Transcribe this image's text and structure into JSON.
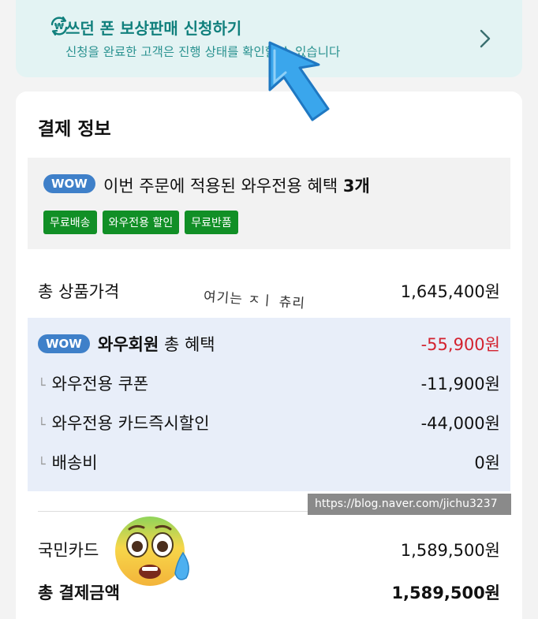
{
  "trade_in": {
    "title": "쓰던 폰 보상판매 신청하기",
    "subtitle": "신청을 완료한 고객은 진행 상태를 확인할 수 있습니다",
    "icon": "won-refresh-icon",
    "chevron": "chevron-right-icon"
  },
  "payment": {
    "title": "결제 정보",
    "wow_badge": "WOW",
    "wow_intro": "이번 주문에 적용된 와우전용 혜택",
    "wow_count": "3개",
    "chips": [
      "무료배송",
      "와우전용 할인",
      "무료반품"
    ],
    "product_total_label": "총 상품가격",
    "product_total_value": "1,645,400원",
    "benefit": {
      "badge": "WOW",
      "title_bold": "와우회원",
      "title_rest": "총 혜택",
      "total": "-55,900원",
      "items": [
        {
          "tick": "└",
          "label": "와우전용 쿠폰",
          "value": "-11,900원"
        },
        {
          "tick": "└",
          "label": "와우전용 카드즉시할인",
          "value": "-44,000원"
        },
        {
          "tick": "└",
          "label": "배송비",
          "value": "0원"
        }
      ]
    },
    "card_label": "국민카드",
    "card_value": "1,589,500원",
    "grand_total_label": "총 결제금액",
    "grand_total_value": "1,589,500원"
  },
  "overlay": {
    "handwritten_note": "여기는 ㅈㅣ 츄리",
    "watermark": "https://blog.naver.com/jichu3237",
    "arrow_color": "#3aa6ec",
    "emoji": "flushed-face-sweat-emoji"
  },
  "colors": {
    "teal": "#11807d",
    "wow_blue": "#3f80c9",
    "chip_green": "#118f26",
    "discount_red": "#d3222f",
    "benefit_bg": "#e8eef9"
  }
}
